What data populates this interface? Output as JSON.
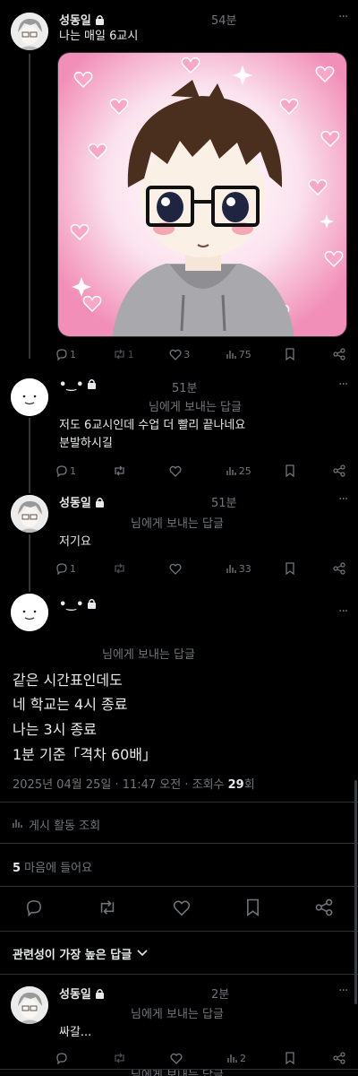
{
  "colors": {
    "background": "#000000",
    "text": "#e7e9ea",
    "muted": "#71767b",
    "divider": "#2f3336",
    "heart_pink": "#f7a8c8"
  },
  "post1": {
    "author": "성동일",
    "time": "54분",
    "text": "나는 매일 6교시",
    "image_alt": "anime-style boy with glasses on pink heart background",
    "stats": {
      "replies": "1",
      "reposts": "1",
      "likes": "3",
      "views": "75"
    }
  },
  "reply1": {
    "author": "•‿•",
    "time": "51분",
    "reply_to": "님에게 보내는 답글",
    "lines": [
      "저도 6교시인데 수업 더 빨리 끝나네요",
      "분발하시길"
    ],
    "stats": {
      "replies": "1",
      "reposts": "",
      "likes": "",
      "views": "25"
    }
  },
  "reply2": {
    "author": "성동일",
    "time": "51분",
    "reply_to": "님에게 보내는 답글",
    "text": "저기요",
    "stats": {
      "replies": "1",
      "reposts": "",
      "likes": "",
      "views": "33"
    }
  },
  "main_post": {
    "author": "•‿•",
    "reply_to": "님에게 보내는 답글",
    "lines": [
      "같은 시간표인데도",
      "네 학교는 4시 종료",
      "나는 3시 종료",
      "1분 기준「격차 60배」"
    ],
    "datetime": "2025년 04월 25일 · 11:47 오전 · 조회수 ",
    "views": "29",
    "views_suffix": "회",
    "activity_label": "게시 활동 조회",
    "likes_count": "5",
    "likes_label": " 마음에 들어요"
  },
  "sort": {
    "label": "관련성이 가장 높은 답글"
  },
  "reply3": {
    "author": "성동일",
    "time": "2분",
    "reply_to": "님에게 보내는 답글",
    "text": "싸갈...",
    "stats": {
      "replies": "",
      "reposts": "",
      "likes": "",
      "views": "2"
    }
  },
  "next_reply": {
    "reply_to": "님에게 보내는 답글"
  },
  "icons": [
    "reply-icon",
    "repost-icon",
    "like-icon",
    "views-icon",
    "bookmark-icon",
    "share-icon",
    "lock-icon",
    "more-icon",
    "chevron-down-icon",
    "activity-icon"
  ]
}
